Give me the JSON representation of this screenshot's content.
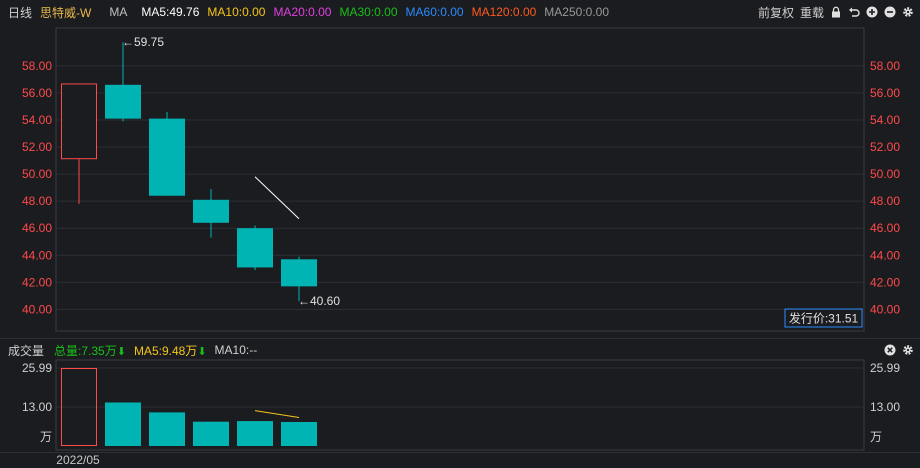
{
  "header": {
    "period": "日线",
    "stock_name": "思特威-W",
    "ma_label": "MA",
    "ma5": "MA5:49.76",
    "ma10": "MA10:0.00",
    "ma20": "MA20:0.00",
    "ma30": "MA30:0.00",
    "ma60": "MA60:0.00",
    "ma120": "MA120:0.00",
    "ma250": "MA250:0.00",
    "adjust": "前复权",
    "overlay": "重载",
    "colors": {
      "ma5": "#ffffff",
      "ma10": "#f5c518",
      "ma20": "#e040e0",
      "ma30": "#18c018",
      "ma60": "#2a8cff",
      "ma120": "#ff5a1e",
      "ma250": "#9a9a9a"
    }
  },
  "volume_header": {
    "title": "成交量",
    "total": "总量:7.35万",
    "ma5": "MA5:9.48万",
    "ma10": "MA10:--"
  },
  "issue_price_label": "发行价:31.51",
  "chart_data": [
    {
      "type": "candlestick",
      "ylim": [
        38.4,
        60.8
      ],
      "yticks": [
        "40.00",
        "42.00",
        "44.00",
        "46.00",
        "48.00",
        "50.00",
        "52.00",
        "54.00",
        "56.00",
        "58.00"
      ],
      "candles": [
        {
          "open": 51.1,
          "close": 56.7,
          "high": 56.7,
          "low": 47.8,
          "direction": "up"
        },
        {
          "open": 56.6,
          "close": 54.1,
          "high": 59.75,
          "low": 53.9,
          "direction": "down"
        },
        {
          "open": 54.1,
          "close": 48.4,
          "high": 54.6,
          "low": 48.4,
          "direction": "down"
        },
        {
          "open": 48.1,
          "close": 46.4,
          "high": 48.9,
          "low": 45.3,
          "direction": "down"
        },
        {
          "open": 46.0,
          "close": 43.1,
          "high": 46.2,
          "low": 42.9,
          "direction": "down"
        },
        {
          "open": 43.7,
          "close": 41.7,
          "high": 43.9,
          "low": 40.6,
          "direction": "down"
        }
      ],
      "annotations": [
        {
          "candle": 1,
          "value": 59.75,
          "text": "←59.75"
        },
        {
          "candle": 5,
          "value": 40.6,
          "text": "←40.60"
        }
      ],
      "ma5_line": [
        {
          "candle": 4,
          "value": 49.8
        },
        {
          "candle": 5,
          "value": 46.7
        }
      ],
      "colors": {
        "up": "#ff4a4a",
        "down": "#00b4b4",
        "ma5": "#ffffff"
      }
    },
    {
      "type": "bar",
      "unit": "万",
      "xlabel": "2022/05",
      "ylim": [
        0,
        25.99
      ],
      "yticks": [
        "25.99",
        "13.00",
        "万"
      ],
      "values": [
        25.99,
        14.5,
        11.2,
        8.1,
        8.3,
        8.0
      ],
      "directions": [
        "up",
        "down",
        "down",
        "down",
        "down",
        "down"
      ],
      "ma5_line": [
        {
          "bar": 4,
          "value": 11.8
        },
        {
          "bar": 5,
          "value": 9.48
        }
      ],
      "colors": {
        "up": "#ff4a4a",
        "down": "#00b4b4",
        "ma5": "#f5c518"
      }
    }
  ]
}
